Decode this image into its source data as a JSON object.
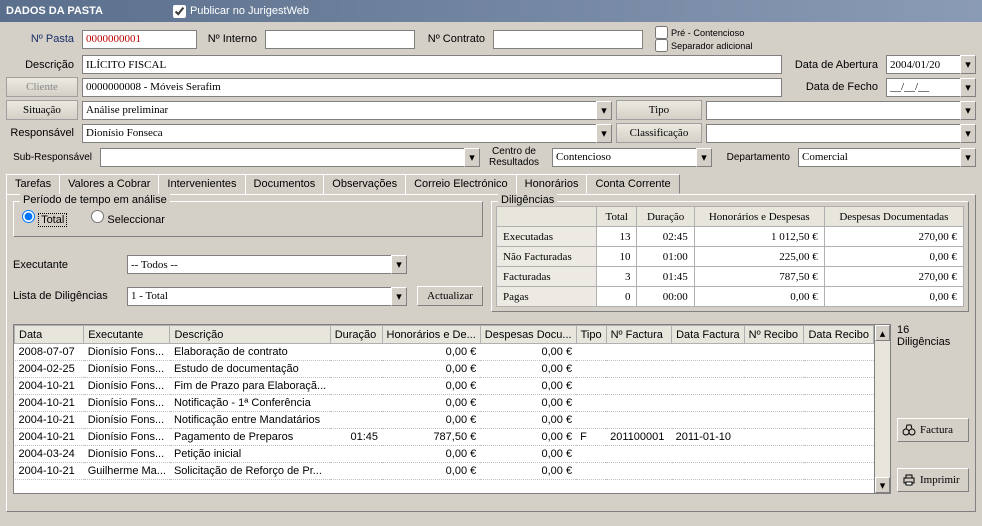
{
  "window": {
    "title": "DADOS DA PASTA",
    "publish_label": "Publicar no JurigestWeb",
    "publish_checked": true
  },
  "header": {
    "pasta_lbl": "Nº Pasta",
    "pasta_val": "0000000001",
    "interno_lbl": "Nº Interno",
    "interno_val": "",
    "contrato_lbl": "Nº Contrato",
    "contrato_val": "",
    "pre_lbl": "Pré - Contencioso",
    "sep_lbl": "Separador adicional",
    "desc_lbl": "Descrição",
    "desc_val": "ILÍCITO FISCAL",
    "abertura_lbl": "Data de Abertura",
    "abertura_val": "2004/01/20",
    "cliente_lbl": "Cliente",
    "cliente_val": "0000000008 - Móveis Serafim",
    "fecho_lbl": "Data de Fecho",
    "fecho_val": "__/__/__",
    "situacao_lbl": "Situação",
    "situacao_val": "Análise preliminar",
    "tipo_lbl": "Tipo",
    "tipo_val": "",
    "responsavel_lbl": "Responsável",
    "responsavel_val": "Dionísio Fonseca",
    "classificacao_lbl": "Classificação",
    "classificacao_val": "",
    "subresp_lbl": "Sub-Responsável",
    "subresp_val": "",
    "centro_lbl": "Centro de Resultados",
    "centro_val": "Contencioso",
    "departamento_lbl": "Departamento",
    "departamento_val": "Comercial"
  },
  "tabs": {
    "tarefas": "Tarefas",
    "valores": "Valores a Cobrar",
    "intervenientes": "Intervenientes",
    "documentos": "Documentos",
    "observacoes": "Observações",
    "correio": "Correio Electrónico",
    "honorarios": "Honorários",
    "conta": "Conta Corrente"
  },
  "periodo": {
    "title": "Período de tempo em análise",
    "total": "Total",
    "seleccionar": "Seleccionar",
    "executante_lbl": "Executante",
    "executante_val": "-- Todos --",
    "lista_lbl": "Lista de Diligências",
    "lista_val": "1 - Total",
    "actualizar": "Actualizar"
  },
  "diligencias": {
    "title": "Diligências",
    "cols": {
      "total": "Total",
      "duracao": "Duração",
      "hon": "Honorários e Despesas",
      "desp": "Despesas Documentadas"
    },
    "rows": [
      {
        "label": "Executadas",
        "total": "13",
        "dur": "02:45",
        "hon": "1 012,50 €",
        "desp": "270,00 €"
      },
      {
        "label": "Não Facturadas",
        "total": "10",
        "dur": "01:00",
        "hon": "225,00 €",
        "desp": "0,00 €"
      },
      {
        "label": "Facturadas",
        "total": "3",
        "dur": "01:45",
        "hon": "787,50 €",
        "desp": "270,00 €"
      },
      {
        "label": "Pagas",
        "total": "0",
        "dur": "00:00",
        "hon": "0,00 €",
        "desp": "0,00 €"
      }
    ]
  },
  "grid": {
    "cols": {
      "data": "Data",
      "exec": "Executante",
      "desc": "Descrição",
      "dur": "Duração",
      "hon": "Honorários e De...",
      "desp": "Despesas Docu...",
      "tipo": "Tipo",
      "nfact": "Nº Factura",
      "dfact": "Data Factura",
      "nrec": "Nº Recibo",
      "drec": "Data Recibo"
    },
    "rows": [
      {
        "data": "2008-07-07",
        "exec": "Dionísio Fons...",
        "desc": "Elaboração de contrato",
        "dur": "",
        "hon": "0,00 €",
        "desp": "0,00 €",
        "tipo": "",
        "nf": "",
        "df": "",
        "nr": "",
        "dr": ""
      },
      {
        "data": "2004-02-25",
        "exec": "Dionísio Fons...",
        "desc": "Estudo de documentação",
        "dur": "",
        "hon": "0,00 €",
        "desp": "0,00 €",
        "tipo": "",
        "nf": "",
        "df": "",
        "nr": "",
        "dr": ""
      },
      {
        "data": "2004-10-21",
        "exec": "Dionísio Fons...",
        "desc": "Fim de Prazo para Elaboraçã...",
        "dur": "",
        "hon": "0,00 €",
        "desp": "0,00 €",
        "tipo": "",
        "nf": "",
        "df": "",
        "nr": "",
        "dr": ""
      },
      {
        "data": "2004-10-21",
        "exec": "Dionísio Fons...",
        "desc": "Notificação - 1ª Conferência",
        "dur": "",
        "hon": "0,00 €",
        "desp": "0,00 €",
        "tipo": "",
        "nf": "",
        "df": "",
        "nr": "",
        "dr": ""
      },
      {
        "data": "2004-10-21",
        "exec": "Dionísio Fons...",
        "desc": "Notificação entre Mandatários",
        "dur": "",
        "hon": "0,00 €",
        "desp": "0,00 €",
        "tipo": "",
        "nf": "",
        "df": "",
        "nr": "",
        "dr": ""
      },
      {
        "data": "2004-10-21",
        "exec": "Dionísio Fons...",
        "desc": "Pagamento de Preparos",
        "dur": "01:45",
        "hon": "787,50 €",
        "desp": "0,00 €",
        "tipo": "F",
        "nf": "201100001",
        "df": "2011-01-10",
        "nr": "",
        "dr": ""
      },
      {
        "data": "2004-03-24",
        "exec": "Dionísio Fons...",
        "desc": "Petição inicial",
        "dur": "",
        "hon": "0,00 €",
        "desp": "0,00 €",
        "tipo": "",
        "nf": "",
        "df": "",
        "nr": "",
        "dr": ""
      },
      {
        "data": "2004-10-21",
        "exec": "Guilherme Ma...",
        "desc": "Solicitação de Reforço de Pr...",
        "dur": "",
        "hon": "0,00 €",
        "desp": "0,00 €",
        "tipo": "",
        "nf": "",
        "df": "",
        "nr": "",
        "dr": ""
      }
    ],
    "count_num": "16",
    "count_lbl": "Diligências"
  },
  "side": {
    "factura": "Factura",
    "imprimir": "Imprimir"
  }
}
